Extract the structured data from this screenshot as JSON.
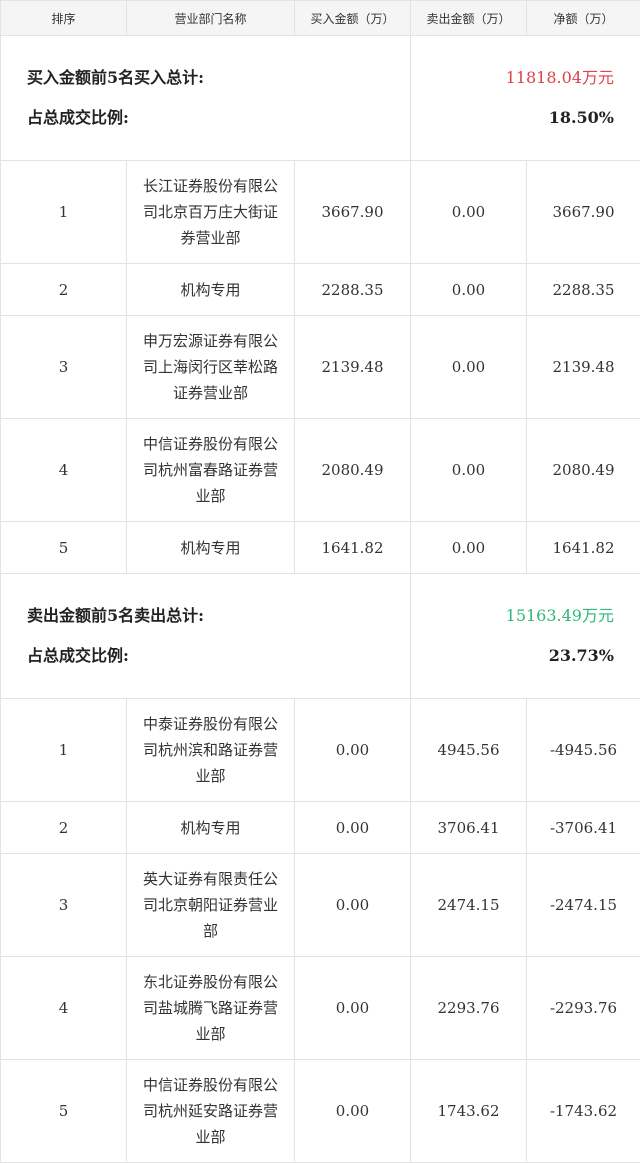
{
  "headers": [
    "排序",
    "营业部门名称",
    "买入金额（万）",
    "卖出金额（万）",
    "净额（万）"
  ],
  "buy_section": {
    "total_label": "买入金额前5名买入总计:",
    "total_value": "11818.04万元",
    "ratio_label": "占总成交比例:",
    "ratio_value": "18.50%",
    "rows": [
      {
        "rank": "1",
        "name": "长江证券股份有限公司北京百万庄大街证券营业部",
        "buy": "3667.90",
        "sell": "0.00",
        "net": "3667.90"
      },
      {
        "rank": "2",
        "name": "机构专用",
        "buy": "2288.35",
        "sell": "0.00",
        "net": "2288.35"
      },
      {
        "rank": "3",
        "name": "申万宏源证券有限公司上海闵行区莘松路证券营业部",
        "buy": "2139.48",
        "sell": "0.00",
        "net": "2139.48"
      },
      {
        "rank": "4",
        "name": "中信证券股份有限公司杭州富春路证券营业部",
        "buy": "2080.49",
        "sell": "0.00",
        "net": "2080.49"
      },
      {
        "rank": "5",
        "name": "机构专用",
        "buy": "1641.82",
        "sell": "0.00",
        "net": "1641.82"
      }
    ]
  },
  "sell_section": {
    "total_label": "卖出金额前5名卖出总计:",
    "total_value": "15163.49万元",
    "ratio_label": "占总成交比例:",
    "ratio_value": "23.73%",
    "rows": [
      {
        "rank": "1",
        "name": "中泰证券股份有限公司杭州滨和路证券营业部",
        "buy": "0.00",
        "sell": "4945.56",
        "net": "-4945.56"
      },
      {
        "rank": "2",
        "name": "机构专用",
        "buy": "0.00",
        "sell": "3706.41",
        "net": "-3706.41"
      },
      {
        "rank": "3",
        "name": "英大证券有限责任公司北京朝阳证券营业部",
        "buy": "0.00",
        "sell": "2474.15",
        "net": "-2474.15"
      },
      {
        "rank": "4",
        "name": "东北证券股份有限公司盐城腾飞路证券营业部",
        "buy": "0.00",
        "sell": "2293.76",
        "net": "-2293.76"
      },
      {
        "rank": "5",
        "name": "中信证券股份有限公司杭州延安路证券营业部",
        "buy": "0.00",
        "sell": "1743.62",
        "net": "-1743.62"
      }
    ]
  },
  "colors": {
    "buy_total": "#e0414a",
    "sell_total": "#2fb67c",
    "header_bg": "#f5f5f5",
    "border": "#e3e3e3"
  }
}
